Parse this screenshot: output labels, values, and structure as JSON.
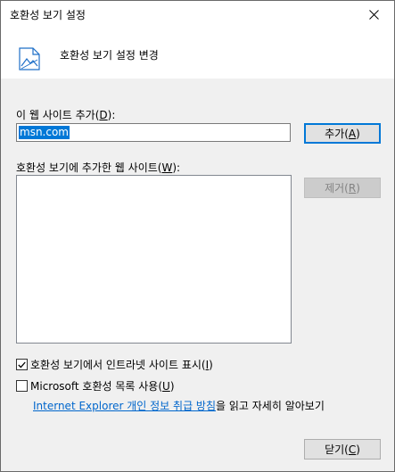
{
  "window": {
    "title": "호환성 보기 설정"
  },
  "header": {
    "heading": "호환성 보기 설정 변경"
  },
  "add_site": {
    "label_text": "이 웹 사이트 추가(",
    "label_mnemonic": "D",
    "label_suffix": "):",
    "value": "msn.com",
    "add_button_text": "추가(",
    "add_button_mnemonic": "A",
    "add_button_suffix": ")"
  },
  "site_list": {
    "label_text": "호환성 보기에 추가한 웹 사이트(",
    "label_mnemonic": "W",
    "label_suffix": "):",
    "remove_button_text": "제거(",
    "remove_button_mnemonic": "R",
    "remove_button_suffix": ")",
    "items": []
  },
  "options": {
    "intranet_label": "호환성 보기에서 인트라넷 사이트 표시(",
    "intranet_mnemonic": "I",
    "intranet_suffix": ")",
    "intranet_checked": true,
    "microsoft_list_label": "Microsoft 호환성 목록 사용(",
    "microsoft_list_mnemonic": "U",
    "microsoft_list_suffix": ")",
    "microsoft_list_checked": false
  },
  "privacy": {
    "link_text": "Internet Explorer 개인 정보 취급 방침",
    "trailing_text": "을 읽고 자세히 알아보기"
  },
  "footer": {
    "close_button_text": "닫기(",
    "close_button_mnemonic": "C",
    "close_button_suffix": ")"
  },
  "colors": {
    "accent": "#0078d7",
    "link": "#0066cc",
    "dialog_bg": "#f0f0f0"
  }
}
